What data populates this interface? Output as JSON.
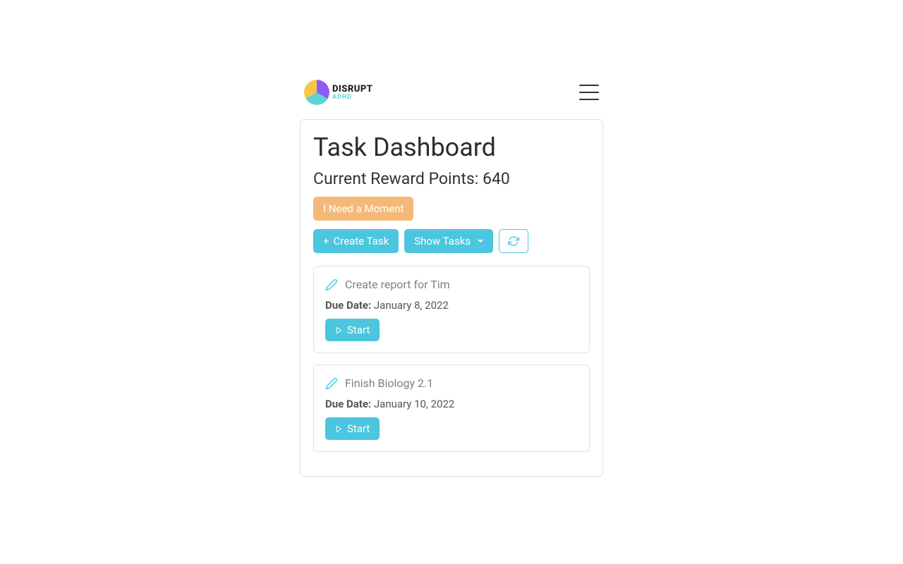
{
  "logo": {
    "main": "DISRUPT",
    "sub": "ADHD"
  },
  "page": {
    "title": "Task Dashboard",
    "reward_label": "Current Reward Points: ",
    "reward_value": "640"
  },
  "buttons": {
    "moment": "I Need a Moment",
    "create": "Create Task",
    "show_tasks": "Show Tasks",
    "start": "Start"
  },
  "labels": {
    "due_date": "Due Date: "
  },
  "tasks": [
    {
      "title": "Create report for Tim",
      "due": "January 8, 2022"
    },
    {
      "title": "Finish Biology 2.1",
      "due": "January 10, 2022"
    }
  ]
}
